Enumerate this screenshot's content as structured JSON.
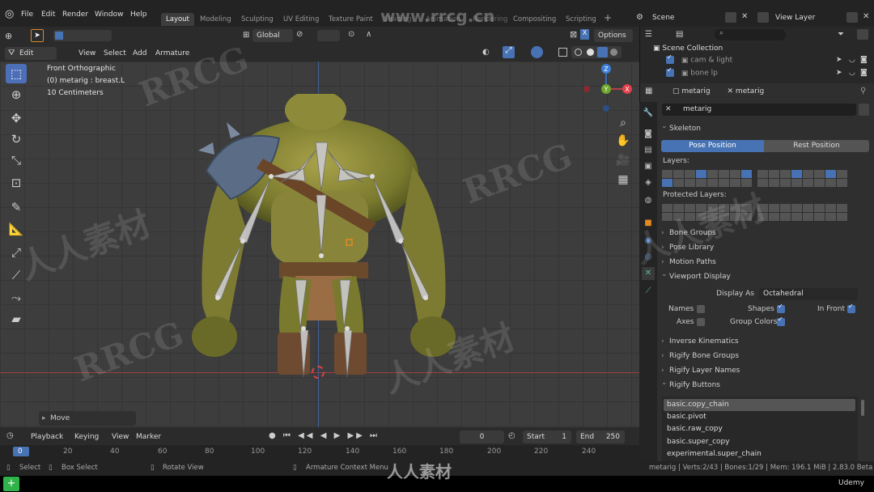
{
  "topbar": {
    "menus": [
      "File",
      "Edit",
      "Render",
      "Window",
      "Help"
    ],
    "workspaces": [
      "Layout",
      "Modeling",
      "Sculpting",
      "UV Editing",
      "Texture Paint",
      "Shading",
      "Animation",
      "Rendering",
      "Compositing",
      "Scripting"
    ],
    "scene": "Scene",
    "view_layer": "View Layer"
  },
  "viewport_header": {
    "mode": "Edit Mode",
    "menus": [
      "View",
      "Select",
      "Add",
      "Armature"
    ],
    "orientation": "Global",
    "options": "Options"
  },
  "viewport": {
    "info_line1": "Front Orthographic",
    "info_line2": "(0) metarig : breast.L",
    "info_line3": "10 Centimeters",
    "operator_panel": "Move",
    "axes": {
      "z": "Z",
      "x": "X",
      "y": "Y"
    }
  },
  "timeline": {
    "menus": [
      "Playback",
      "Keying",
      "View",
      "Marker"
    ],
    "current_frame": "0",
    "start_label": "Start",
    "start": "1",
    "end_label": "End",
    "end": "250",
    "ticks": [
      "0",
      "20",
      "40",
      "60",
      "80",
      "100",
      "120",
      "140",
      "160",
      "180",
      "200",
      "220",
      "240"
    ]
  },
  "statusbar": {
    "select": "Select",
    "box_select": "Box Select",
    "rotate_view": "Rotate View",
    "context_menu": "Armature Context Menu",
    "stats": "metarig | Verts:2/43 | Bones:1/29 | Mem: 196.1 MiB | 2.83.0 Beta"
  },
  "outliner": {
    "root": "Scene Collection",
    "items": [
      "cam & light",
      "bone lp"
    ]
  },
  "properties": {
    "object_name": "metarig",
    "data_name": "metarig",
    "armature_name": "metarig",
    "skeleton": "Skeleton",
    "pose_position": "Pose Position",
    "rest_position": "Rest Position",
    "layers": "Layers:",
    "protected_layers": "Protected Layers:",
    "sections": [
      "Bone Groups",
      "Pose Library",
      "Motion Paths"
    ],
    "viewport_display": "Viewport Display",
    "display_as_label": "Display As",
    "display_as": "Octahedral",
    "names": "Names",
    "shapes": "Shapes",
    "in_front": "In Front",
    "axes": "Axes",
    "group_colors": "Group Colors",
    "sections2": [
      "Inverse Kinematics",
      "Rigify Bone Groups",
      "Rigify Layer Names"
    ],
    "rigify_buttons": "Rigify Buttons",
    "rig_list": [
      "basic.copy_chain",
      "basic.pivot",
      "basic.raw_copy",
      "basic.super_copy",
      "experimental.super_chain"
    ]
  },
  "watermarks": {
    "site": "www.rrcg.cn",
    "logo": "RRCG",
    "cn": "人人素材",
    "udemy": "Udemy"
  },
  "colors": {
    "accent": "#4772b3",
    "active_tool": "#4d6fb8",
    "axis_x": "#e0404a",
    "axis_y": "#6fa82b",
    "axis_z": "#3d7ed8",
    "bone": "#c8c8c8"
  }
}
